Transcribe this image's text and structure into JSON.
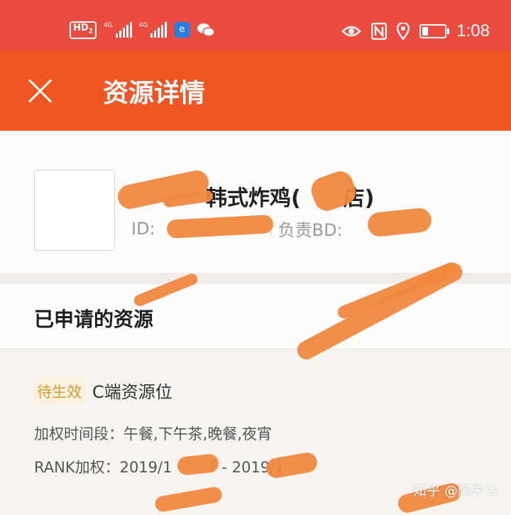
{
  "status_bar": {
    "hd_label": "HD",
    "hd_sub": "2",
    "sim1_label": "4G",
    "sim2_label": "4G",
    "app_icon_glyph": "e",
    "time": "1:08"
  },
  "header": {
    "title": "资源详情"
  },
  "store": {
    "name": "韩式炸鸡(",
    "name_suffix": "店)",
    "id_label": "ID:",
    "bd_label": "负责BD:"
  },
  "section": {
    "title": "已申请的资源"
  },
  "resource": {
    "status_badge": "待生效",
    "name": "C端资源位",
    "time_slots_label": "加权时间段：午餐,下午茶,晚餐,夜宵",
    "rank_label": "RANK加权：2019/1",
    "rank_mid": "7 - 2019/1"
  },
  "watermark": "知乎 @陶朱公",
  "colors": {
    "status_bar": "#ec4b3f",
    "app_bar": "#ef5624",
    "badge_text": "#d39b34",
    "redaction": "#f0883f"
  }
}
